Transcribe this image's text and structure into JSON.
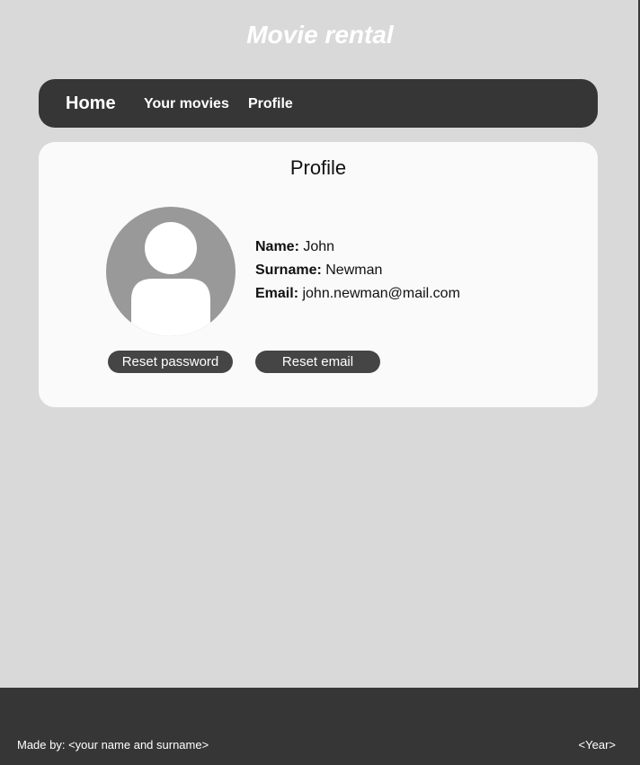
{
  "app": {
    "title": "Movie rental"
  },
  "nav": {
    "home": "Home",
    "your_movies": "Your movies",
    "profile": "Profile"
  },
  "profile_card": {
    "title": "Profile",
    "avatar_icon": "user-avatar-icon",
    "fields": [
      {
        "label": "Name:",
        "value": "John"
      },
      {
        "label": "Surname:",
        "value": "Newman"
      },
      {
        "label": "Email:",
        "value": "john.newman@mail.com"
      }
    ],
    "reset_password_label": "Reset password",
    "reset_email_label": "Reset email"
  },
  "footer": {
    "credit": "Made by: <your name and surname>",
    "year": "<Year>"
  },
  "colors": {
    "background": "#d9d9d9",
    "dark": "#363636",
    "card": "#fafafa",
    "avatar": "#999999",
    "button": "#454545"
  }
}
